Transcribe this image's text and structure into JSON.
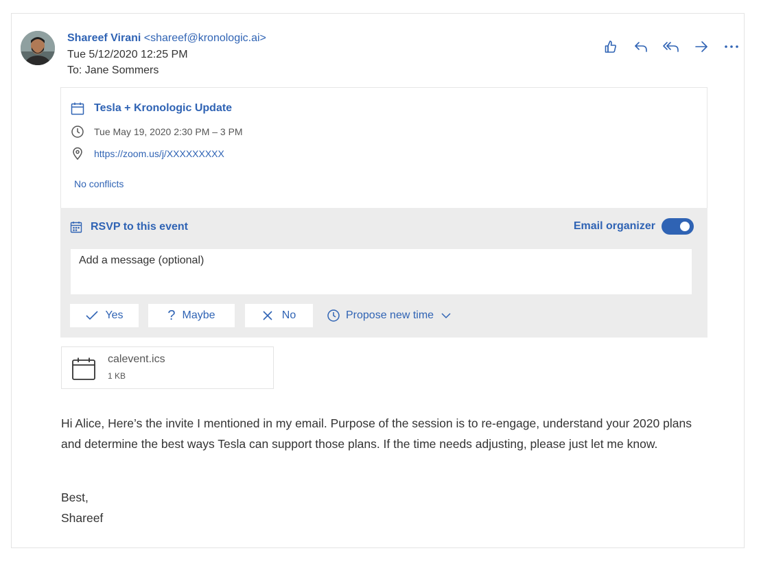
{
  "message": {
    "sender_name": "Shareef Virani",
    "sender_email": "<shareef@kronologic.ai>",
    "date": "Tue 5/12/2020 12:25 PM",
    "to": "To: Jane Sommers"
  },
  "actions": [
    {
      "icon": "like-icon"
    },
    {
      "icon": "reply-icon"
    },
    {
      "icon": "reply-all-icon"
    },
    {
      "icon": "forward-icon"
    },
    {
      "icon": "more-icon"
    }
  ],
  "event": {
    "title": "Tesla + Kronologic Update",
    "time": "Tue May 19, 2020 2:30 PM – 3 PM",
    "location": "https://zoom.us/j/XXXXXXXXX",
    "conflicts": "No conflicts"
  },
  "rsvp": {
    "title": "RSVP to this event",
    "email_organizer": "Email organizer",
    "email_organizer_on": true,
    "message_placeholder": "Add a message (optional)",
    "buttons": {
      "yes": "Yes",
      "maybe": "Maybe",
      "no": "No",
      "propose": "Propose new time"
    }
  },
  "attachment": {
    "name": "calevent.ics",
    "size": "1 KB"
  },
  "body": {
    "text": "Hi Alice, Here’s the invite I mentioned in my email. Purpose of the session is to re-engage, understand your 2020 plans and determine the best ways Tesla can support those plans. If the time needs adjusting, please just let me know.",
    "closing": "Best,",
    "signature": "Shareef"
  },
  "colors": {
    "accent": "#2f63b4",
    "rsvp_background": "#ececec"
  }
}
